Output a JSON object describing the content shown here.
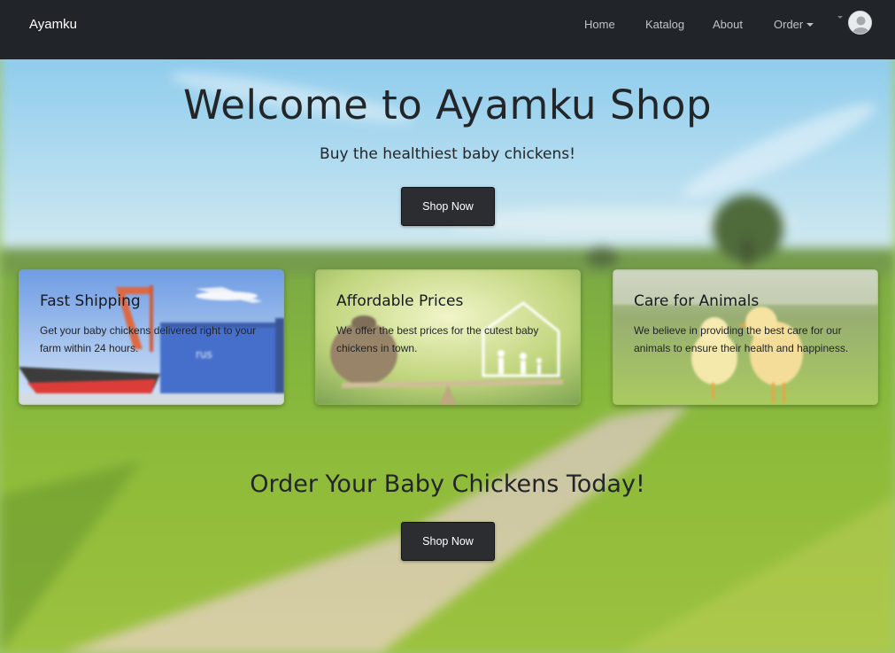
{
  "navbar": {
    "brand": "Ayamku",
    "links": {
      "home": "Home",
      "katalog": "Katalog",
      "about": "About",
      "order": "Order"
    },
    "avatar_icon": "user-avatar-icon"
  },
  "hero": {
    "title": "Welcome to Ayamku Shop",
    "subtitle": "Buy the healthiest baby chickens!",
    "button": "Shop Now"
  },
  "features": [
    {
      "title": "Fast Shipping",
      "text": "Get your baby chickens delivered right to your farm within 24 hours.",
      "image": "shipping-image"
    },
    {
      "title": "Affordable Prices",
      "text": "We offer the best prices for the cutest baby chickens in town.",
      "image": "prices-image"
    },
    {
      "title": "Care for Animals",
      "text": "We believe in providing the best care for our animals to ensure their health and happiness.",
      "image": "chicks-image"
    }
  ],
  "cta": {
    "title": "Order Your Baby Chickens Today!",
    "button": "Shop Now"
  },
  "colors": {
    "navbar_bg": "#212529",
    "button_bg": "#2b2d30",
    "sky": "#8ccbed",
    "field": "#7fb33c"
  }
}
